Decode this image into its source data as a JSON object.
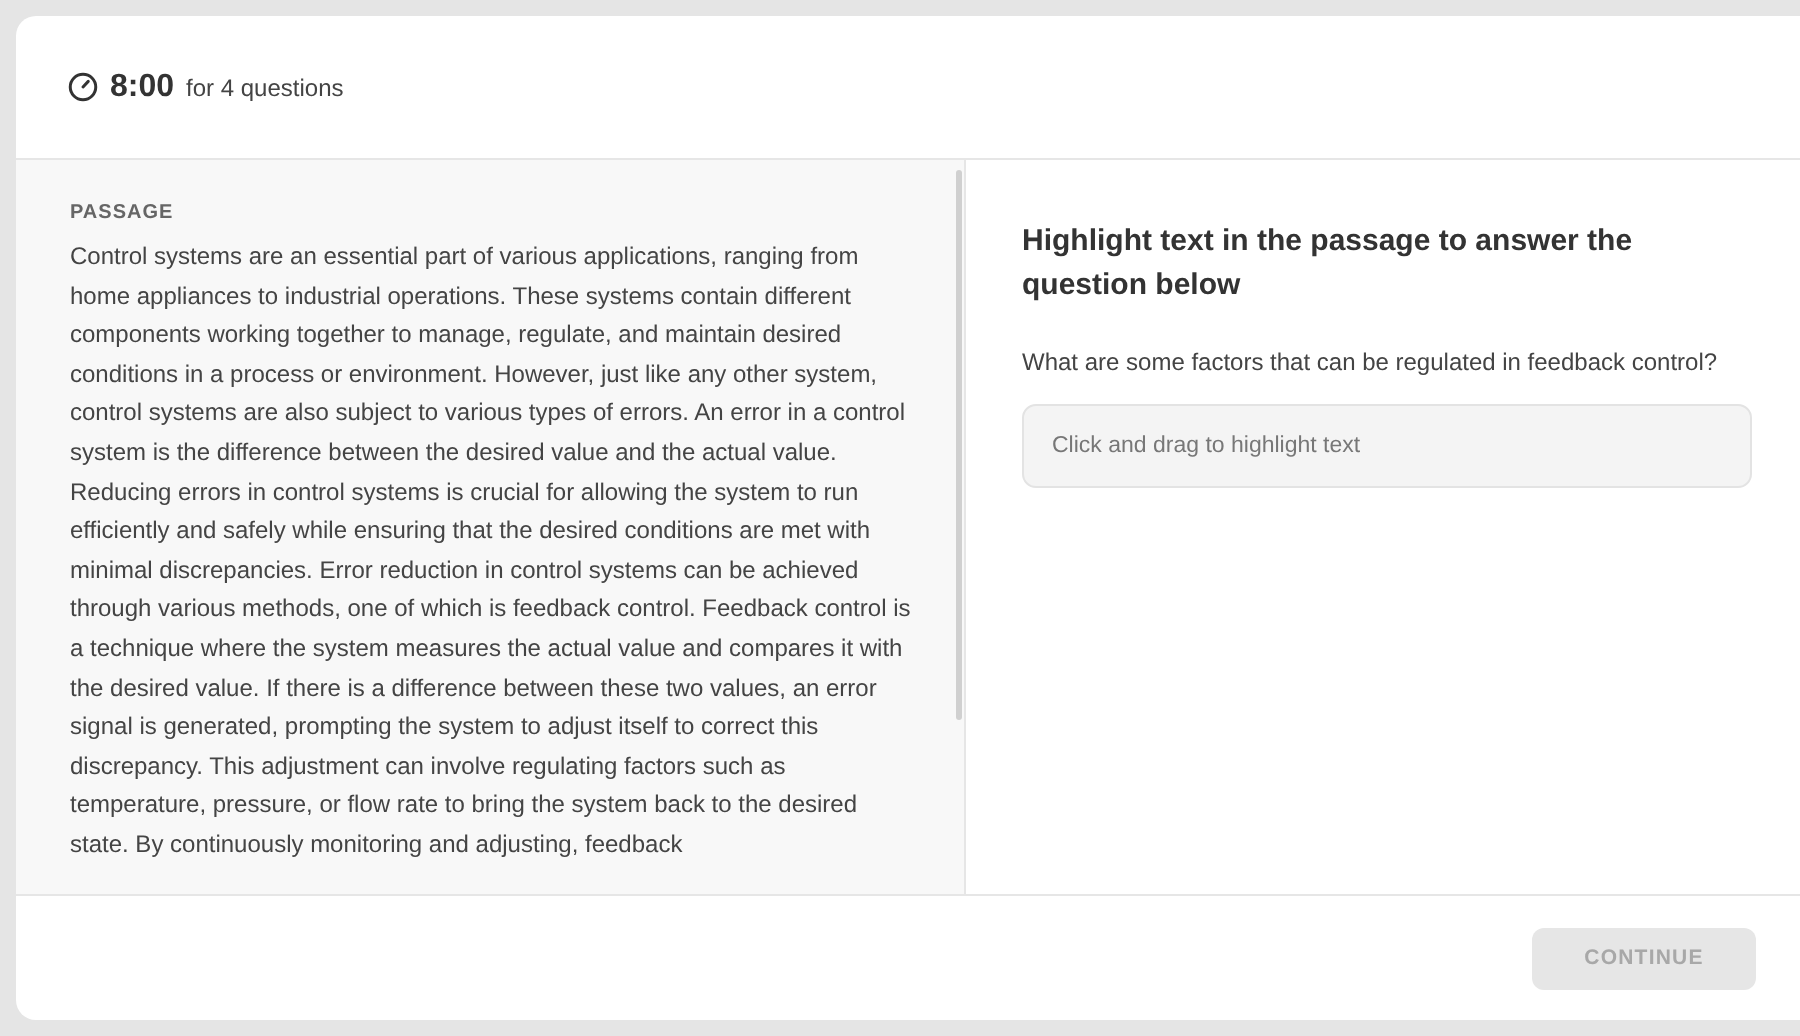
{
  "header": {
    "time": "8:00",
    "suffix": "for 4 questions"
  },
  "passage": {
    "label": "PASSAGE",
    "text": "Control systems are an essential part of various applications, ranging from home appliances to industrial operations. These systems contain different components working together to manage, regulate, and maintain desired conditions in a process or environment. However, just like any other system, control systems are also subject to various types of errors. An error in a control system is the difference between the desired value and the actual value. Reducing errors in control systems is crucial for allowing the system to run efficiently and safely while ensuring that the desired conditions are met with minimal discrepancies. Error reduction in control systems can be achieved through various methods, one of which is feedback control. Feedback control is a technique where the system measures the actual value and compares it with the desired value. If there is a difference between these two values, an error signal is generated, prompting the system to adjust itself to correct this discrepancy. This adjustment can involve regulating factors such as temperature, pressure, or flow rate to bring the system back to the desired state. By continuously monitoring and adjusting, feedback"
  },
  "question": {
    "instruction": "Highlight text in the passage to answer the question below",
    "prompt": "What are some factors that can be regulated in feedback control?",
    "answer": {
      "placeholder": "Click and drag to highlight text"
    }
  },
  "footer": {
    "button": {
      "label": "CONTINUE",
      "disabled": true
    }
  }
}
